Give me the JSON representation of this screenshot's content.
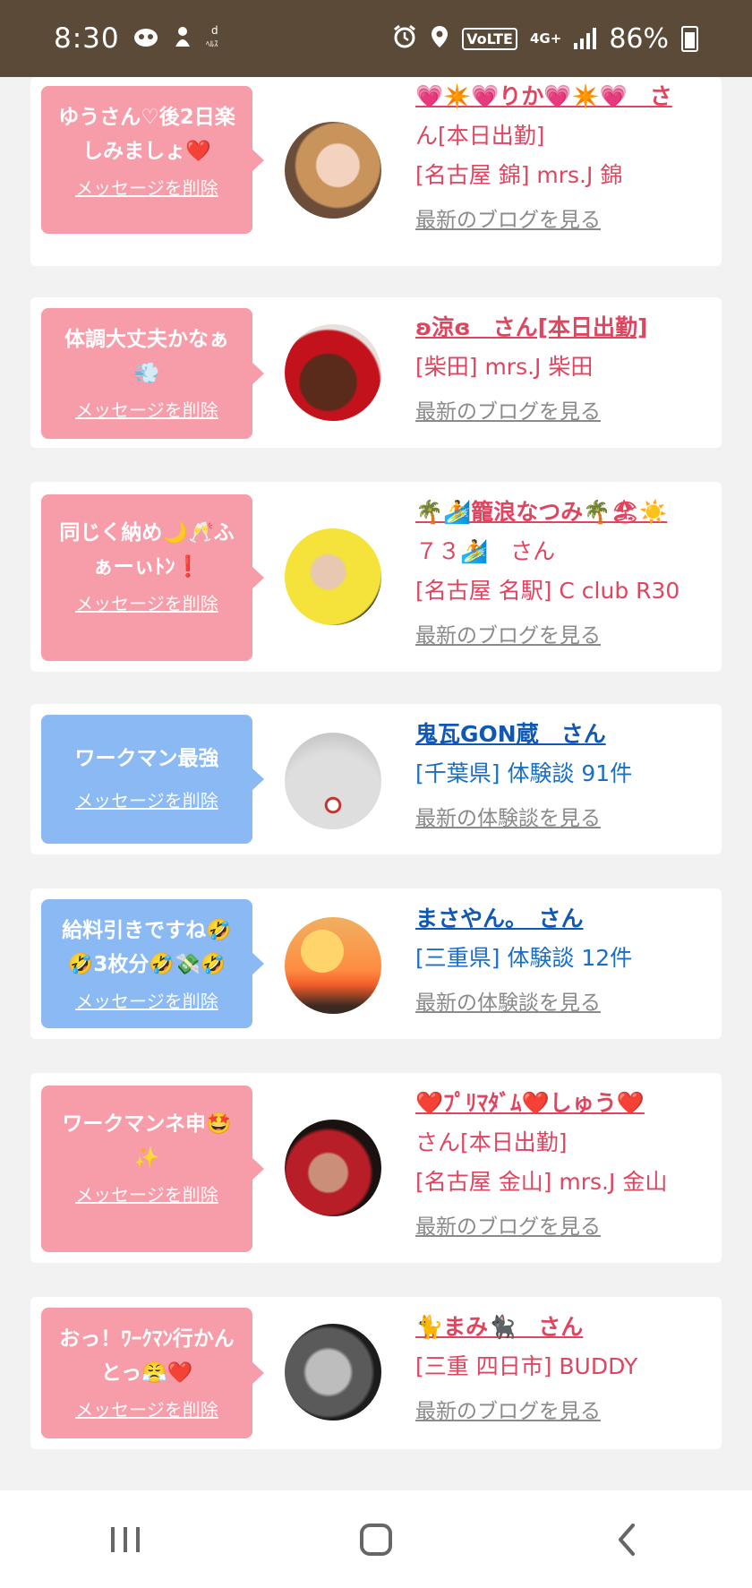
{
  "status_bar": {
    "time": "8:30",
    "volte": "VoLTE",
    "network": "4G+",
    "battery": "86%"
  },
  "cards": [
    {
      "bubble_color": "pink",
      "message_lines": [
        "ゆうさん♡後2日楽",
        "しみましょ❤️"
      ],
      "delete_label": "メッセージを削除",
      "name_line1": "💗✴️💗りか💗✴️💗　さ",
      "name_line2": "ん[本日出勤]",
      "shop": "[名古屋 錦] mrs.J 錦",
      "link": "最新のブログを見る",
      "avatar_icon": "avatar-photo-rika"
    },
    {
      "bubble_color": "pink",
      "message_lines": [
        "体調大丈夫かなぁ",
        "💨"
      ],
      "delete_label": "メッセージを削除",
      "name_line1": "ʚ涼ɞ　さん[本日出勤]",
      "name_line2": "",
      "shop": "[柴田] mrs.J 柴田",
      "link": "最新のブログを見る",
      "avatar_icon": "avatar-photo-ryo"
    },
    {
      "bubble_color": "pink",
      "message_lines": [
        "同じく納め🌙🥂ふ",
        "ぁーぃﾄﾝ❗️"
      ],
      "delete_label": "メッセージを削除",
      "name_line1": "🌴🏄籠浪なつみ🌴🏖☀️",
      "name_line2": "７３🏄　さん",
      "shop": "[名古屋 名駅] C club R30",
      "link": "最新のブログを見る",
      "avatar_icon": "avatar-photo-natsumi"
    },
    {
      "bubble_color": "blue",
      "message_lines": [
        "ワークマン最強"
      ],
      "delete_label": "メッセージを削除",
      "name_line1": "鬼瓦GON蔵　さん",
      "name_line2": "",
      "shop": "[千葉県] 体験談 91件",
      "link": "最新の体験談を見る",
      "avatar_icon": "avatar-photo-gonzo"
    },
    {
      "bubble_color": "blue",
      "message_lines": [
        "給料引きですね🤣",
        "🤣3枚分🤣💸🤣"
      ],
      "delete_label": "メッセージを削除",
      "name_line1": "まさやん。　さん",
      "name_line2": "",
      "shop": "[三重県] 体験談 12件",
      "link": "最新の体験談を見る",
      "avatar_icon": "avatar-photo-masayan"
    },
    {
      "bubble_color": "pink",
      "message_lines": [
        "ワークマンネ申🤩",
        "✨"
      ],
      "delete_label": "メッセージを削除",
      "name_line1": "❤️ﾌﾟﾘﾏﾀﾞﾑ❤️しゅう❤️",
      "name_line2": "さん[本日出勤]",
      "shop": "[名古屋 金山] mrs.J 金山",
      "link": "最新のブログを見る",
      "avatar_icon": "avatar-photo-shu"
    },
    {
      "bubble_color": "pink",
      "message_lines": [
        "おっ！ﾜｰｸﾏﾝ行かん",
        "とっ😤❤️"
      ],
      "delete_label": "メッセージを削除",
      "name_line1": "🐈まみ🐈‍⬛　さん",
      "name_line2": "",
      "shop": "[三重 四日市] BUDDY",
      "link": "最新のブログを見る",
      "avatar_icon": "avatar-photo-mami"
    }
  ],
  "colors": {
    "status_bar": "#5c4a38",
    "pink_bubble": "#f79daa",
    "blue_bubble": "#8ab9f4",
    "pink_text": "#e0455f",
    "blue_text": "#1a6fc4"
  },
  "nav": {
    "recent_icon": "recent-apps-icon",
    "home_icon": "home-icon",
    "back_icon": "back-icon"
  }
}
